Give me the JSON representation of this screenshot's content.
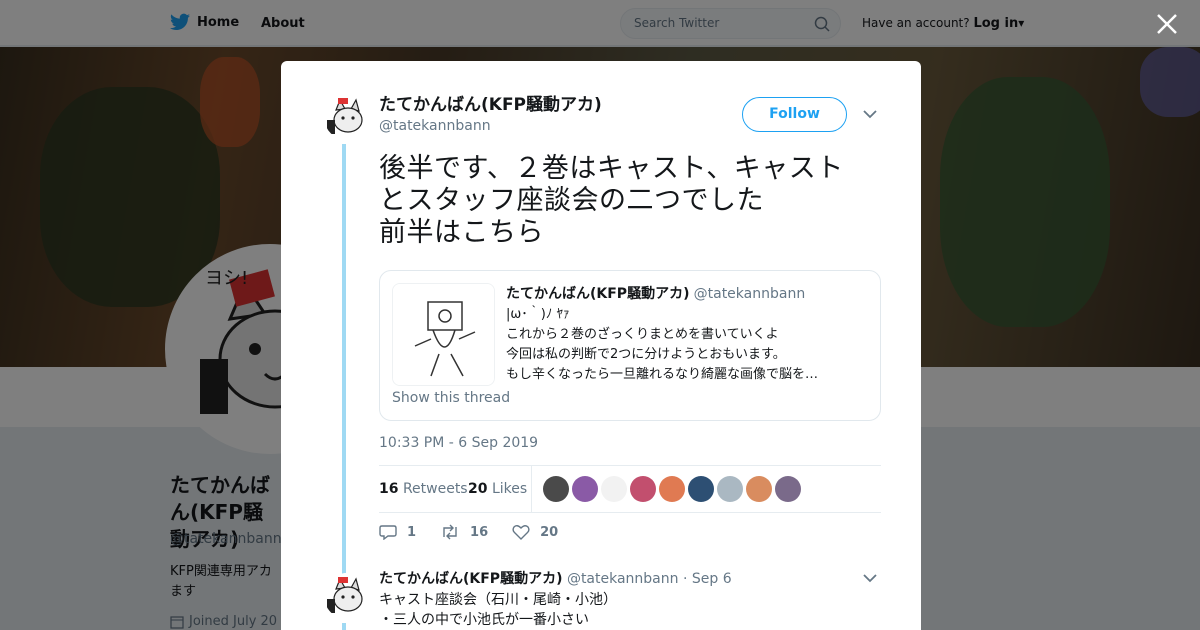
{
  "nav": {
    "home": "Home",
    "about": "About",
    "search_placeholder": "Search Twitter",
    "have_account": "Have an account?",
    "login": "Log in"
  },
  "profile": {
    "name": "たてかんばん(KFP騒動アカ)",
    "handle": "@tatekannbann",
    "bio": "KFP関連専用アカ",
    "bio_more": "ます",
    "joined": "Joined July 20"
  },
  "tweet": {
    "author_name": "たてかんばん(KFP騒動アカ)",
    "author_handle": "@tatekannbann",
    "follow_label": "Follow",
    "text_lines": [
      "後半です、２巻はキャスト、キャスト",
      "とスタッフ座談会の二つでした",
      "前半はこちら"
    ],
    "timestamp": "10:33 PM - 6 Sep 2019",
    "retweets": "16",
    "retweets_label": "Retweets",
    "likes": "20",
    "likes_label": "Likes",
    "likers": [
      {
        "name": "liker-1",
        "color": "#4a4a4a"
      },
      {
        "name": "liker-2",
        "color": "#8a5aa6"
      },
      {
        "name": "liker-3",
        "color": "#f2f2f2"
      },
      {
        "name": "liker-4",
        "color": "#c24f6e"
      },
      {
        "name": "liker-5",
        "color": "#e07a52"
      },
      {
        "name": "liker-6",
        "color": "#2d4f73"
      },
      {
        "name": "liker-7",
        "color": "#aab8c2"
      },
      {
        "name": "liker-8",
        "color": "#d98c5f"
      },
      {
        "name": "liker-9",
        "color": "#7a6a8a"
      }
    ],
    "reply_count": "1",
    "retweet_count": "16",
    "like_count": "20"
  },
  "quote": {
    "name": "たてかんばん(KFP騒動アカ)",
    "handle": "@tatekannbann",
    "lines": [
      "|ω･｀)ﾉ ﾔｧ",
      "これから２巻のざっくりまとめを書いていくよ",
      "今回は私の判断で2つに分けようとおもいます。",
      "もし辛くなったら一旦離れるなり綺麗な画像で脳を…"
    ],
    "show_thread": "Show this thread"
  },
  "reply": {
    "name": "たてかんばん(KFP騒動アカ)",
    "handle": "@tatekannbann",
    "date": "· Sep 6",
    "lines": [
      "キャスト座談会（石川・尾崎・小池）",
      "・三人の中で小池氏が一番小さい"
    ]
  },
  "colors": {
    "accent": "#1da1f2",
    "thread": "#9fd9f3",
    "overlay": "rgba(0,0,0,0.5)"
  }
}
